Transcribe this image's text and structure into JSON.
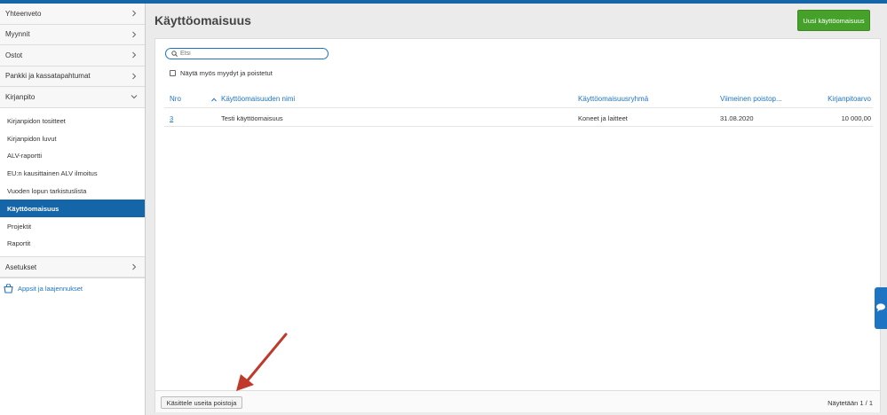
{
  "sidebar": {
    "top_items": [
      {
        "label": "Yhteenveto"
      },
      {
        "label": "Myynnit"
      },
      {
        "label": "Ostot"
      },
      {
        "label": "Pankki ja kassatapahtumat"
      },
      {
        "label": "Kirjanpito"
      }
    ],
    "sub_items": [
      {
        "label": "Kirjanpidon tositteet"
      },
      {
        "label": "Kirjanpidon luvut"
      },
      {
        "label": "ALV-raportti"
      },
      {
        "label": "EU:n kausittainen ALV ilmoitus"
      },
      {
        "label": "Vuoden lopun tarkistuslista"
      },
      {
        "label": "Käyttöomaisuus"
      },
      {
        "label": "Projektit"
      },
      {
        "label": "Raportit"
      }
    ],
    "settings_label": "Asetukset",
    "apps_label": "Appsit ja laajennukset"
  },
  "page": {
    "title": "Käyttöomaisuus",
    "new_button": "Uusi käyttöomaisuus"
  },
  "search": {
    "placeholder": "Etsi"
  },
  "filter": {
    "show_sold_label": "Näytä myös myydyt ja poistetut"
  },
  "table": {
    "headers": {
      "nro": "Nro",
      "name": "Käyttöomaisuuden nimi",
      "group": "Käyttöomaisuusryhmä",
      "last_dep": "Viimeinen poistop...",
      "book_value": "Kirjanpitoarvo"
    },
    "rows": [
      {
        "nro": "3",
        "name": "Testi käyttöomaisuus",
        "group": "Koneet ja laitteet",
        "last_dep": "31.08.2020",
        "book_value": "10 000,00"
      }
    ]
  },
  "footer": {
    "batch_button": "Käsittele useita poistoja",
    "showing": "Näytetään 1 / 1"
  },
  "colors": {
    "brand_blue": "#1565a9",
    "link_blue": "#1e74c3",
    "green_button": "#45a12a",
    "annotation_arrow": "#c0392b"
  },
  "icons": [
    "chevron-right-icon",
    "chevron-down-icon",
    "search-icon",
    "basket-icon",
    "chat-icon",
    "sort-up-icon"
  ]
}
